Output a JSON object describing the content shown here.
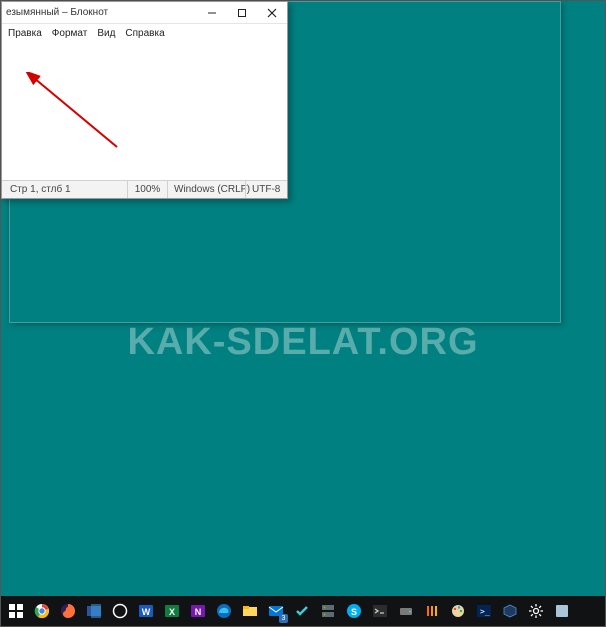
{
  "notepad": {
    "title": "езымянный – Блокнот",
    "menu": {
      "edit": "Правка",
      "format": "Формат",
      "view": "Вид",
      "help": "Справка"
    },
    "status": {
      "position": "Стр 1, стлб 1",
      "zoom": "100%",
      "line_ending": "Windows (CRLF)",
      "encoding": "UTF-8"
    }
  },
  "watermark": "KAK-SDELAT.ORG",
  "taskbar": {
    "items": [
      {
        "name": "start-icon"
      },
      {
        "name": "chrome-icon"
      },
      {
        "name": "firefox-icon"
      },
      {
        "name": "word-icon"
      },
      {
        "name": "circle-icon"
      },
      {
        "name": "word-app-icon"
      },
      {
        "name": "excel-icon"
      },
      {
        "name": "onenote-icon"
      },
      {
        "name": "edge-icon"
      },
      {
        "name": "explorer-icon"
      },
      {
        "name": "mail-icon"
      },
      {
        "name": "todo-icon"
      },
      {
        "name": "server-icon"
      },
      {
        "name": "skype-icon"
      },
      {
        "name": "terminal-icon"
      },
      {
        "name": "hdd-icon"
      },
      {
        "name": "stack-icon"
      },
      {
        "name": "paint-icon"
      },
      {
        "name": "console-icon"
      },
      {
        "name": "box-icon"
      },
      {
        "name": "settings-icon"
      },
      {
        "name": "app-icon"
      }
    ],
    "mail_badge": "3"
  }
}
